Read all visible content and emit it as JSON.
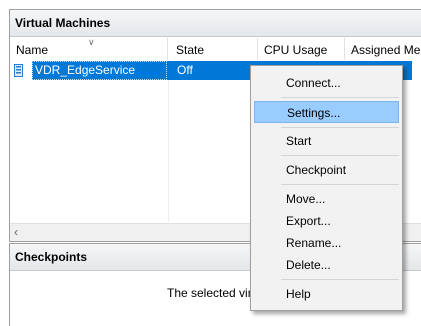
{
  "vm_panel": {
    "title": "Virtual Machines",
    "columns": [
      "Name",
      "State",
      "CPU Usage",
      "Assigned Me"
    ],
    "rows": [
      {
        "name": "VDR_EdgeService",
        "state": "Off"
      }
    ]
  },
  "checkpoints_panel": {
    "title": "Checkpoints",
    "message": "The selected virtu"
  },
  "context_menu": {
    "items": [
      "Connect...",
      "Settings...",
      "Start",
      "Checkpoint",
      "Move...",
      "Export...",
      "Rename...",
      "Delete...",
      "Help"
    ],
    "highlighted": "Settings..."
  },
  "colors": {
    "selection": "#0078d7",
    "menu_highlight": "#99ccff",
    "menu_background": "#f2f2f2"
  },
  "icons": [
    "vm-icon",
    "sort-arrow-icon",
    "scroll-left-icon"
  ]
}
